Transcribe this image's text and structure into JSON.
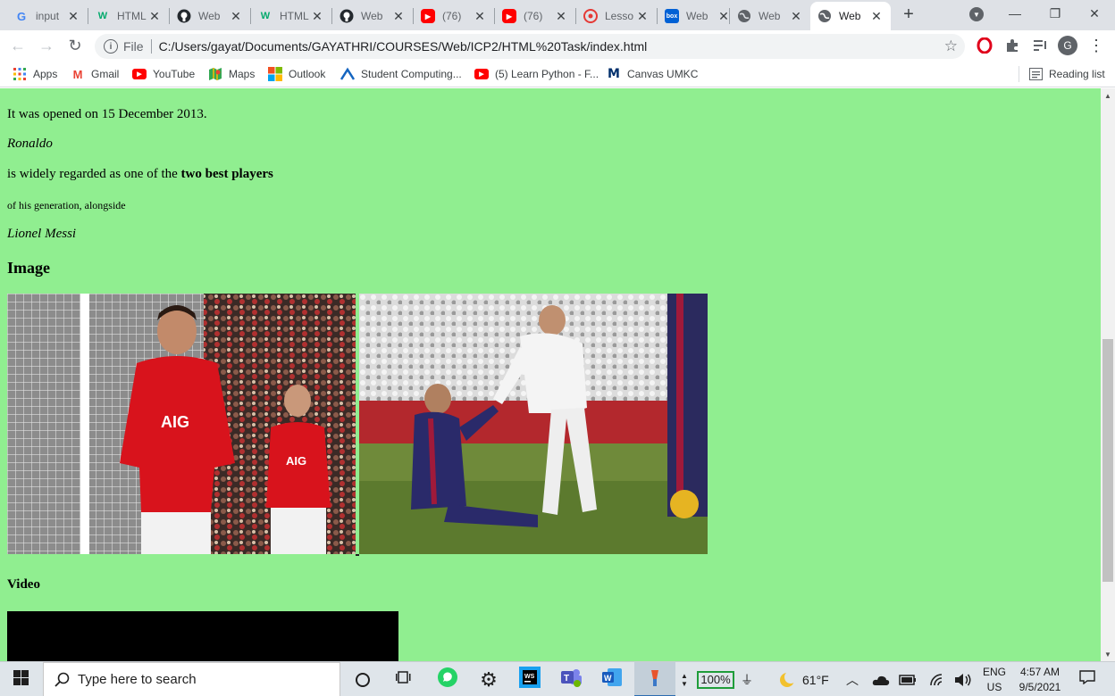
{
  "browser": {
    "tabs": [
      {
        "title": "input",
        "favicon": "google-icon"
      },
      {
        "title": "HTML",
        "favicon": "w3schools-icon"
      },
      {
        "title": "Web",
        "favicon": "github-icon"
      },
      {
        "title": "HTML",
        "favicon": "w3schools-icon"
      },
      {
        "title": "Web",
        "favicon": "github-icon"
      },
      {
        "title": "(76)",
        "favicon": "youtube-icon"
      },
      {
        "title": "(76)",
        "favicon": "youtube-icon"
      },
      {
        "title": "Lesso",
        "favicon": "lesson-icon"
      },
      {
        "title": "Web",
        "favicon": "box-icon"
      },
      {
        "title": "Web",
        "favicon": "globe-icon"
      },
      {
        "title": "Web",
        "favicon": "globe-icon",
        "active": true
      }
    ],
    "new_tab_symbol": "+",
    "address": {
      "scheme": "File",
      "url": "C:/Users/gayat/Documents/GAYATHRI/COURSES/Web/ICP2/HTML%20Task/index.html"
    },
    "profile_initial": "G",
    "bookmarks": [
      {
        "label": "Apps",
        "icon": "apps-grid-icon"
      },
      {
        "label": "Gmail",
        "icon": "gmail-icon"
      },
      {
        "label": "YouTube",
        "icon": "youtube-icon"
      },
      {
        "label": "Maps",
        "icon": "maps-icon"
      },
      {
        "label": "Outlook",
        "icon": "outlook-icon"
      },
      {
        "label": "Student Computing...",
        "icon": "student-computing-icon"
      },
      {
        "label": "(5) Learn Python - F...",
        "icon": "youtube-icon"
      },
      {
        "label": "Canvas UMKC",
        "icon": "canvas-umkc-icon"
      }
    ],
    "reading_list": "Reading list"
  },
  "page": {
    "opened_text": "It was opened on 15 December 2013.",
    "ronaldo": "Ronaldo",
    "regarded_prefix": "is widely regarded as one of the ",
    "regarded_bold": "two best players",
    "generation_text": "of his generation, alongside",
    "messi": "Lionel Messi",
    "image_heading": "Image",
    "video_heading": "Video"
  },
  "taskbar": {
    "search_placeholder": "Type here to search",
    "battery_percent": "100%",
    "weather": "61°F",
    "language": "ENG",
    "region": "US",
    "time": "4:57 AM",
    "date": "9/5/2021"
  },
  "colors": {
    "page_background": "#90ee90",
    "tab_strip": "#dee1e6",
    "youtube_red": "#ff0000"
  }
}
